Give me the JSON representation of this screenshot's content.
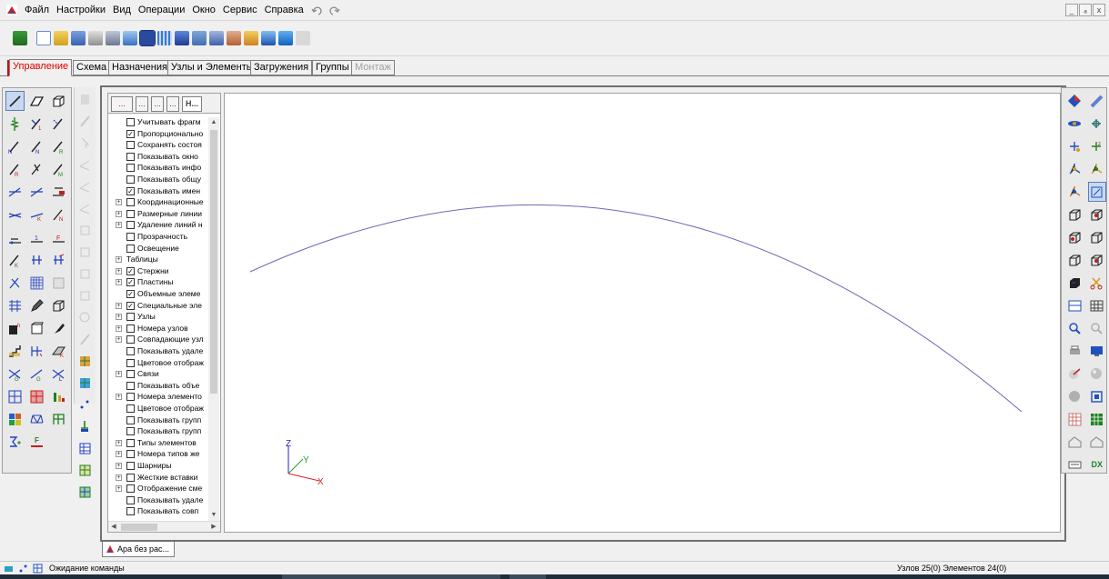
{
  "menu": [
    "Файл",
    "Настройки",
    "Вид",
    "Операции",
    "Окно",
    "Сервис",
    "Справка"
  ],
  "window_controls": [
    "_",
    "ₐ",
    "x"
  ],
  "tabs": [
    {
      "label": "Управление",
      "state": "active"
    },
    {
      "label": "Схема",
      "state": "normal"
    },
    {
      "label": "Назначения",
      "state": "normal"
    },
    {
      "label": "Узлы и Элементы",
      "state": "normal"
    },
    {
      "label": "Загружения",
      "state": "normal"
    },
    {
      "label": "Группы",
      "state": "normal"
    },
    {
      "label": "Монтаж",
      "state": "disabled"
    }
  ],
  "tree_tabs": [
    "...",
    "...",
    "...",
    "...",
    "Н..."
  ],
  "tree": [
    {
      "label": "Учитывать фрагм",
      "checked": false,
      "expander": false
    },
    {
      "label": "Пропорционально",
      "checked": true,
      "expander": false
    },
    {
      "label": "Сохранять состоя",
      "checked": false,
      "expander": false
    },
    {
      "label": "Показывать окно",
      "checked": false,
      "expander": false
    },
    {
      "label": "Показывать инфо",
      "checked": false,
      "expander": false
    },
    {
      "label": "Показывать общу",
      "checked": false,
      "expander": false
    },
    {
      "label": "Показывать имен",
      "checked": true,
      "expander": false
    },
    {
      "label": "Координационные",
      "checked": false,
      "expander": true
    },
    {
      "label": "Размерные линии",
      "checked": false,
      "expander": true
    },
    {
      "label": "Удаление линий н",
      "checked": false,
      "expander": true
    },
    {
      "label": "Прозрачность",
      "checked": false,
      "expander": false
    },
    {
      "label": "Освещение",
      "checked": false,
      "expander": false
    },
    {
      "label": "Таблицы",
      "checked": null,
      "expander": true
    },
    {
      "label": "Стержни",
      "checked": true,
      "expander": true
    },
    {
      "label": "Пластины",
      "checked": true,
      "expander": true
    },
    {
      "label": "Объемные элеме",
      "checked": true,
      "expander": false
    },
    {
      "label": "Специальные эле",
      "checked": true,
      "expander": true
    },
    {
      "label": "Узлы",
      "checked": false,
      "expander": true
    },
    {
      "label": "Номера узлов",
      "checked": false,
      "expander": true
    },
    {
      "label": "Совпадающие узл",
      "checked": false,
      "expander": true
    },
    {
      "label": "Показывать удале",
      "checked": false,
      "expander": false
    },
    {
      "label": "Цветовое отображ",
      "checked": false,
      "expander": false
    },
    {
      "label": "Связи",
      "checked": false,
      "expander": true
    },
    {
      "label": "Показывать объе",
      "checked": false,
      "expander": false
    },
    {
      "label": "Номера элементо",
      "checked": false,
      "expander": true
    },
    {
      "label": "Цветовое отображ",
      "checked": false,
      "expander": false
    },
    {
      "label": "Показывать групп",
      "checked": false,
      "expander": false
    },
    {
      "label": "Показывать групп",
      "checked": false,
      "expander": false
    },
    {
      "label": "Типы элементов",
      "checked": false,
      "expander": true
    },
    {
      "label": "Номера типов же",
      "checked": false,
      "expander": true
    },
    {
      "label": "Шарниры",
      "checked": false,
      "expander": true
    },
    {
      "label": "Жесткие вставки",
      "checked": false,
      "expander": true
    },
    {
      "label": "Отображение сме",
      "checked": false,
      "expander": true
    },
    {
      "label": "Показывать удале",
      "checked": false,
      "expander": false
    },
    {
      "label": "Показывать совп",
      "checked": false,
      "expander": false
    }
  ],
  "axes": {
    "z": "Z",
    "y": "Y",
    "x": "X"
  },
  "document_tab": "Ара без рас...",
  "status": {
    "left": "Ожидание команды",
    "right": "Узлов 25(0) Элементов 24(0)"
  },
  "right_bottom_label": "DX",
  "colors": {
    "accent_red": "#e00000",
    "arc": "#6a6ab8",
    "axis_x": "#e02020",
    "axis_y": "#20a020",
    "axis_z": "#2020c0"
  }
}
